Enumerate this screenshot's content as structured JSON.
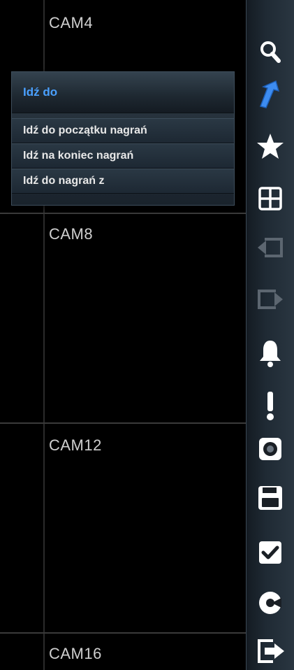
{
  "cameras": [
    {
      "label": "CAM4"
    },
    {
      "label": "CAM8"
    },
    {
      "label": "CAM12"
    },
    {
      "label": "CAM16"
    }
  ],
  "goto_menu": {
    "title": "Idź do",
    "items": [
      {
        "label": "Idź do początku nagrań"
      },
      {
        "label": "Idź na koniec nagrań"
      },
      {
        "label": "Idź do nagrań z"
      }
    ]
  },
  "toolbar": {
    "buttons": [
      {
        "icon": "search-icon"
      },
      {
        "icon": "goto-arrow-icon",
        "active": true
      },
      {
        "icon": "star-icon"
      },
      {
        "icon": "grid-layout-icon"
      },
      {
        "icon": "previous-page-icon",
        "disabled": true
      },
      {
        "icon": "next-page-icon",
        "disabled": true
      },
      {
        "icon": "bell-icon"
      },
      {
        "icon": "exclamation-icon"
      },
      {
        "icon": "snapshot-camera-icon"
      },
      {
        "icon": "save-disk-icon"
      },
      {
        "icon": "checkbox-icon"
      },
      {
        "icon": "playback-icon"
      },
      {
        "icon": "exit-icon"
      }
    ]
  },
  "colors": {
    "menu_title": "#4aa0ff",
    "icon_normal": "#ffffff",
    "icon_active": "#3d8cf0",
    "icon_disabled": "#5c6670"
  }
}
